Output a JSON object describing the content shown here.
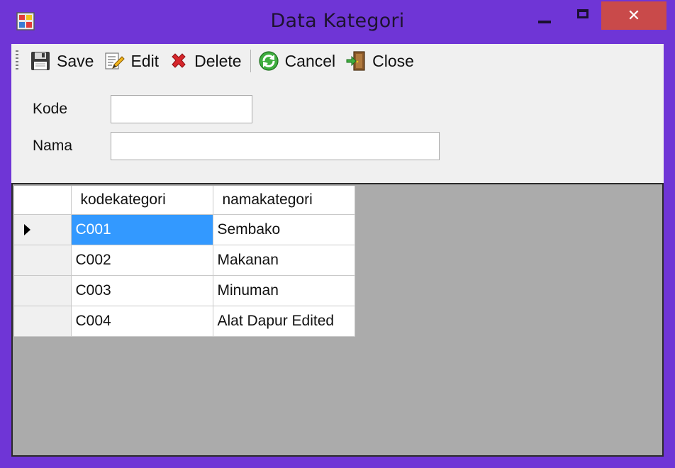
{
  "window": {
    "title": "Data Kategori",
    "close_glyph": "✕"
  },
  "toolbar": {
    "items": [
      {
        "label": "Save",
        "icon": "floppy-disk-icon"
      },
      {
        "label": "Edit",
        "icon": "edit-document-icon"
      },
      {
        "label": "Delete",
        "icon": "red-x-delete-icon"
      },
      {
        "label": "Cancel",
        "icon": "green-refresh-icon"
      },
      {
        "label": "Close",
        "icon": "exit-door-icon"
      }
    ]
  },
  "form": {
    "kode_label": "Kode",
    "kode_value": "",
    "nama_label": "Nama",
    "nama_value": ""
  },
  "grid": {
    "columns": [
      "kodekategori",
      "namakategori"
    ],
    "rows": [
      {
        "kode": "C001",
        "nama": "Sembako",
        "selected": true
      },
      {
        "kode": "C002",
        "nama": "Makanan",
        "selected": false
      },
      {
        "kode": "C003",
        "nama": "Minuman",
        "selected": false
      },
      {
        "kode": "C004",
        "nama": "Alat Dapur Edited",
        "selected": false
      }
    ]
  },
  "colors": {
    "frame": "#6f35d6",
    "close_button": "#c94a4a",
    "selection": "#3399ff",
    "grid_background": "#ababab"
  }
}
